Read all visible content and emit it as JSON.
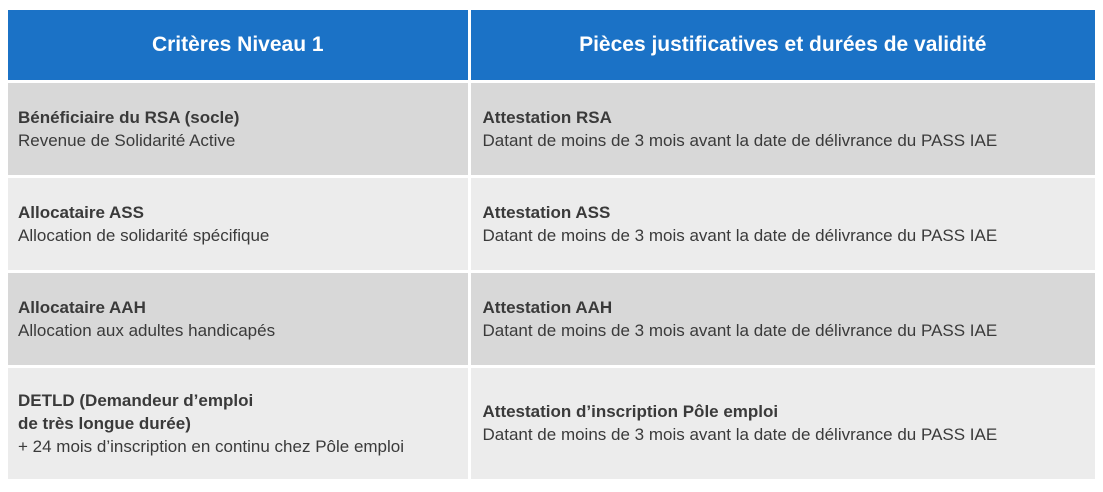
{
  "header": {
    "col1": "Critères Niveau 1",
    "col2": "Pièces justificatives et durées de validité"
  },
  "rows": [
    {
      "criterion_title": "Bénéficiaire du RSA (socle)",
      "criterion_detail": "Revenue de Solidarité Active",
      "document_title": "Attestation RSA",
      "document_detail": "Datant de moins de 3 mois avant la date de délivrance du PASS IAE"
    },
    {
      "criterion_title": "Allocataire ASS",
      "criterion_detail": "Allocation de solidarité spécifique",
      "document_title": "Attestation ASS",
      "document_detail": "Datant de moins de 3 mois avant la date de délivrance du PASS IAE"
    },
    {
      "criterion_title": "Allocataire AAH",
      "criterion_detail": "Allocation aux adultes handicapés",
      "document_title": "Attestation AAH",
      "document_detail": "Datant de moins de 3 mois avant la date de délivrance du PASS IAE"
    },
    {
      "criterion_title_line1": "DETLD (Demandeur d’emploi",
      "criterion_title_line2": "de très longue durée)",
      "criterion_detail": "+ 24 mois d’inscription en continu chez Pôle emploi",
      "document_title": "Attestation d’inscription Pôle emploi",
      "document_detail": "Datant de moins de 3 mois avant la date de délivrance du PASS IAE"
    }
  ],
  "colors": {
    "header_bg": "#1b72c6",
    "row_dark": "#d8d8d8",
    "row_light": "#ececec"
  }
}
